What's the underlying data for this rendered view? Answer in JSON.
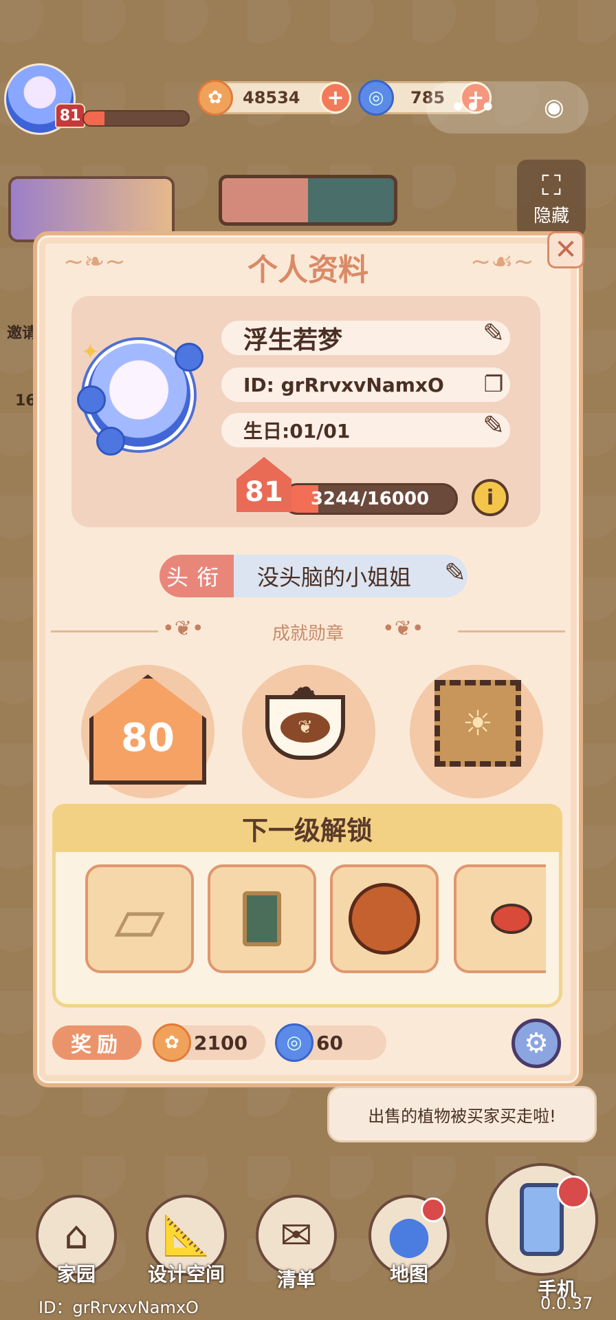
{
  "hud": {
    "player_level": "81",
    "xp_fraction": 0.2,
    "coins": "48534",
    "gems": "785",
    "plus_label": "+",
    "hide_label": "隐藏",
    "side_invite_label": "邀请",
    "side_count": "16"
  },
  "profile": {
    "title": "个人资料",
    "nickname": "浮生若梦",
    "id_text": "ID: grRrvxvNamxO",
    "birthday_text": "生日:01/01",
    "level": "81",
    "xp_text": "3244/16000",
    "xp_fraction": 0.2,
    "info_symbol": "i",
    "close_symbol": "✕",
    "title_tag": "头衔",
    "title_value": "没头脑的小姐姐"
  },
  "achievements": {
    "label": "成就勋章",
    "badges": [
      {
        "name": "level-80-badge",
        "text": "80"
      },
      {
        "name": "latte-badge",
        "text": "♨"
      },
      {
        "name": "stamp-badge",
        "text": "☀"
      }
    ]
  },
  "unlock": {
    "header": "下一级解锁",
    "items": [
      {
        "name": "door-panel",
        "glyph": "▯"
      },
      {
        "name": "easel-board",
        "glyph": "⛿"
      },
      {
        "name": "basketball",
        "glyph": "●"
      },
      {
        "name": "ping-pong-paddles",
        "glyph": "🏓"
      }
    ]
  },
  "reward": {
    "label": "奖励",
    "coins": "2100",
    "gems": "60"
  },
  "toast": {
    "message": "出售的植物被买家买走啦!"
  },
  "nav": {
    "home": "家园",
    "design": "设计空间",
    "list": "清单",
    "map": "地图",
    "phone": "手机"
  },
  "footer": {
    "id_text": "ID：grRrvxvNamxO",
    "version": "0.0.37"
  }
}
